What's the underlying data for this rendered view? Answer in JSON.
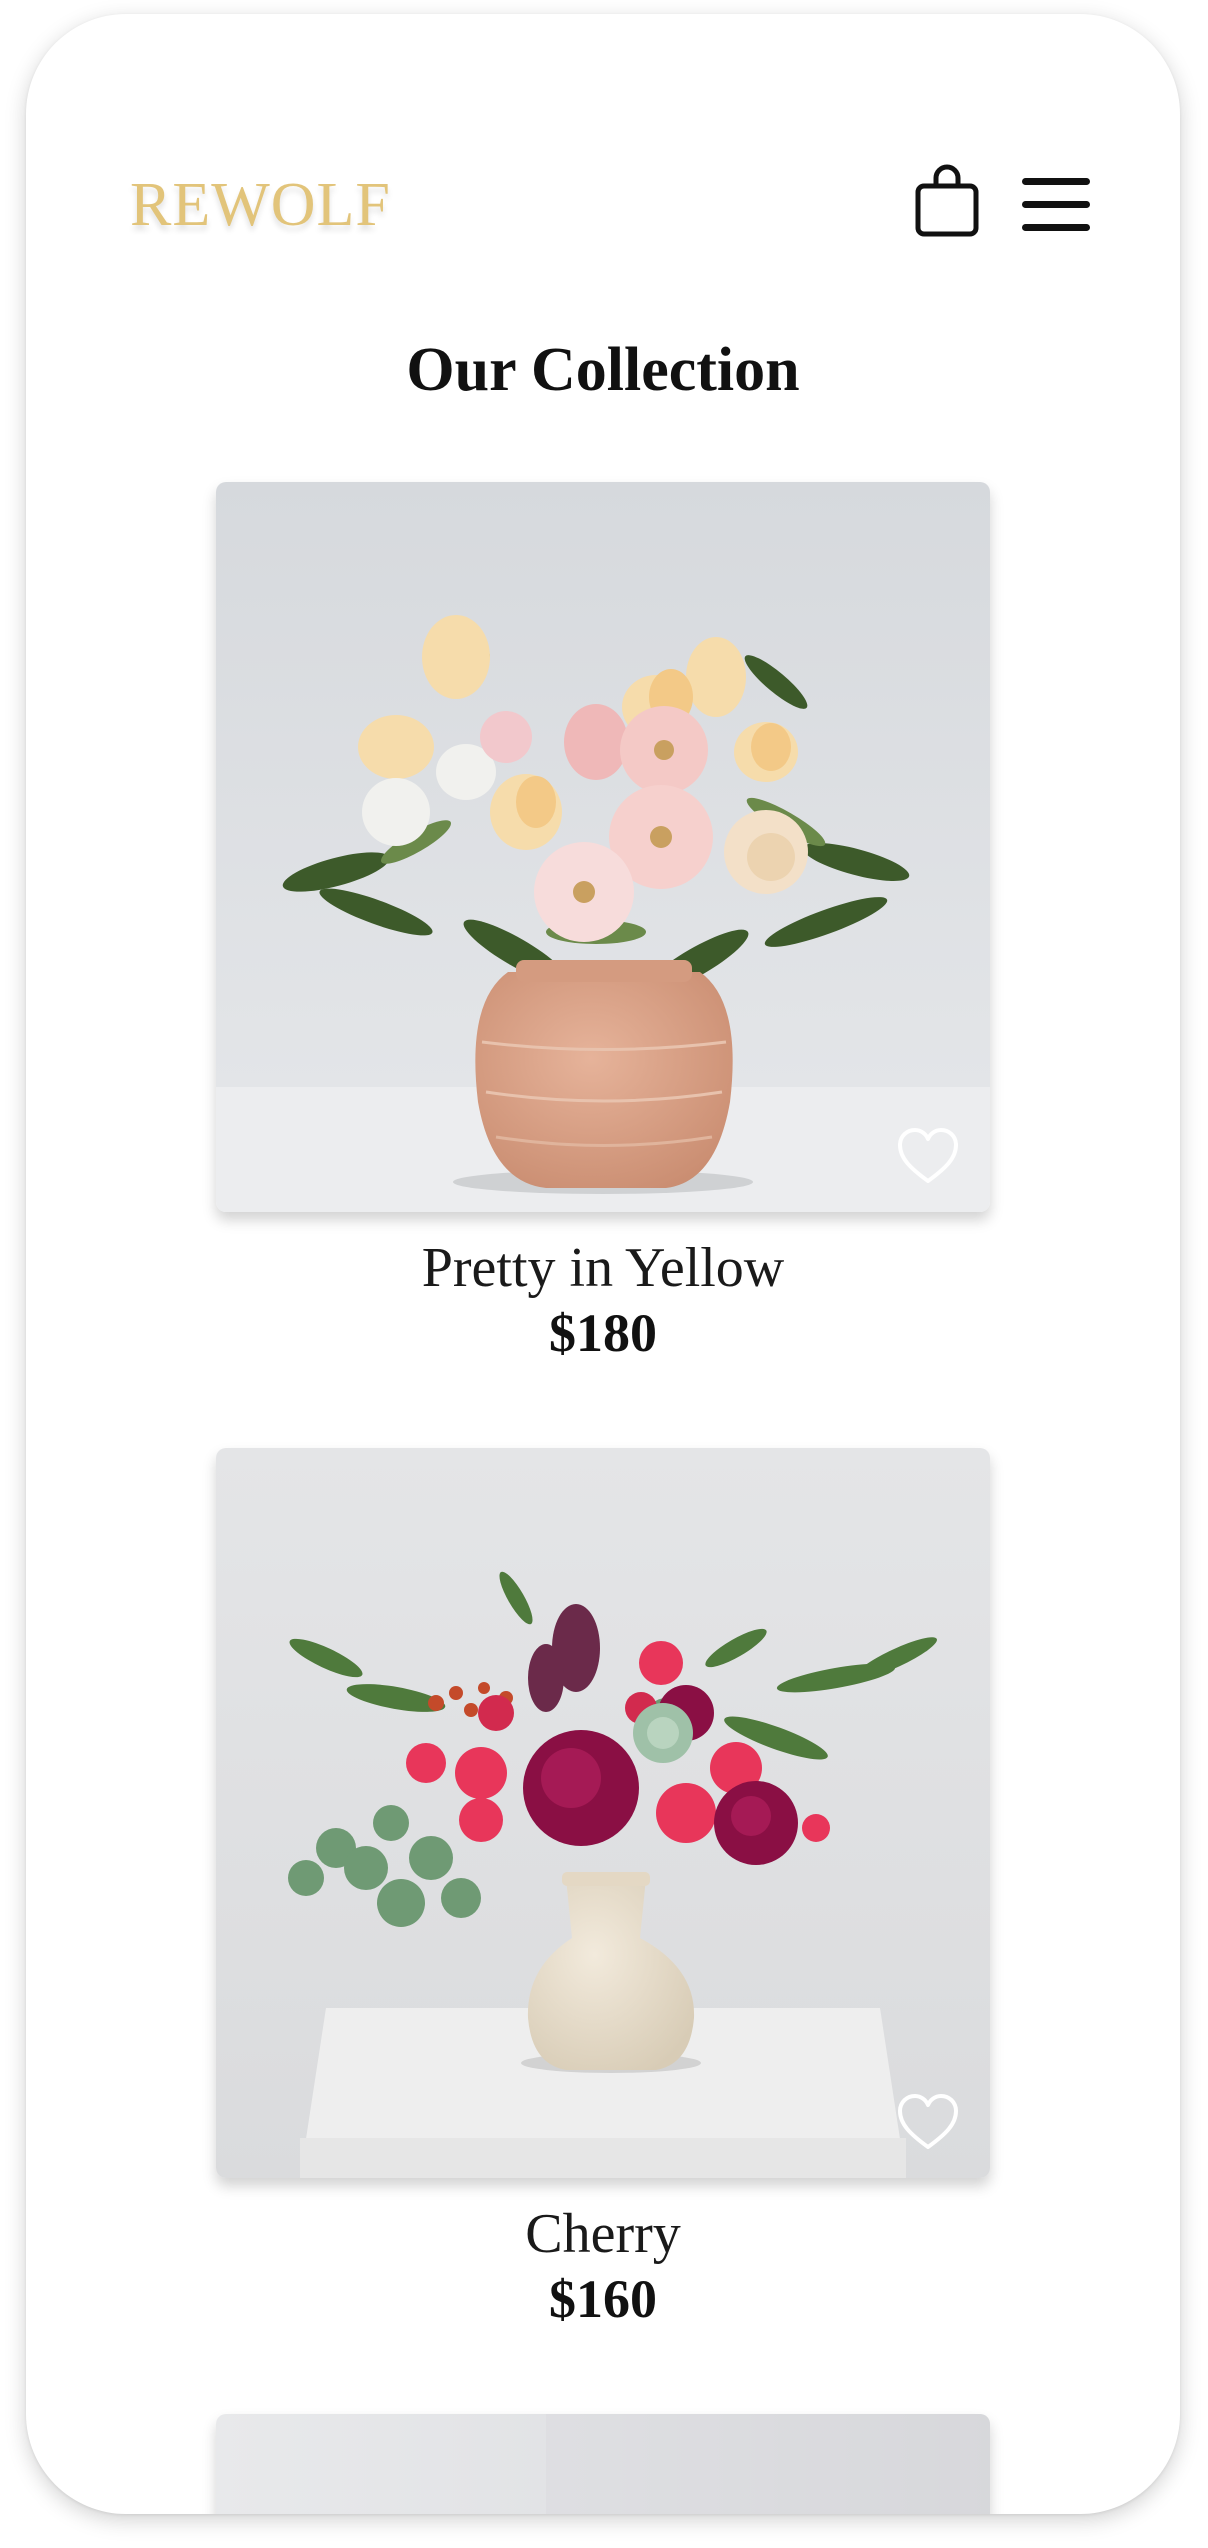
{
  "header": {
    "logo": "REWOLF",
    "logo_color": "#e2c47a",
    "cart_icon": "shopping-bag-icon",
    "menu_icon": "hamburger-menu-icon"
  },
  "page": {
    "title": "Our Collection"
  },
  "products": [
    {
      "name": "Pretty in Yellow",
      "price": "$180",
      "favorite": false,
      "favorite_icon": "heart-outline-icon"
    },
    {
      "name": "Cherry",
      "price": "$160",
      "favorite": false,
      "favorite_icon": "heart-outline-icon"
    }
  ]
}
